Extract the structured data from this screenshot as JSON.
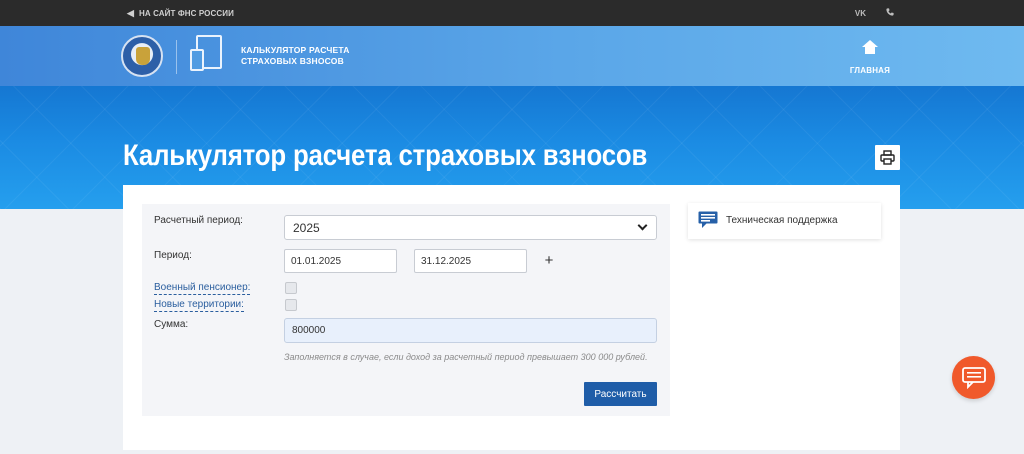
{
  "topbar": {
    "back_link": "НА САЙТ ФНС РОССИИ",
    "vk_label": "VK",
    "phone_icon": "phone-icon"
  },
  "header": {
    "logo_line1": "КАЛЬКУЛЯТОР РАСЧЕТА",
    "logo_line2": "СТРАХОВЫХ ВЗНОСОВ",
    "home_label": "ГЛАВНАЯ"
  },
  "page": {
    "title": "Калькулятор расчета страховых взносов"
  },
  "form": {
    "period_label": "Расчетный период:",
    "period_value": "2025",
    "range_label": "Период:",
    "date_from": "01.01.2025",
    "date_to": "31.12.2025",
    "add_label": "+",
    "military_label": "Военный пенсионер:",
    "military_checked": false,
    "territories_label": "Новые территории:",
    "territories_checked": false,
    "sum_label": "Сумма:",
    "sum_value": "800000",
    "hint": "Заполняется в случае, если доход за расчетный период превышает 300 000 рублей.",
    "submit_label": "Рассчитать"
  },
  "support": {
    "label": "Техническая поддержка"
  },
  "colors": {
    "header_bar": "#2b2b2b",
    "hero_blue": "#1b8be3",
    "primary_button": "#1f5da8",
    "chat_button": "#f0592b",
    "sum_field_bg": "#e8f0fc"
  }
}
